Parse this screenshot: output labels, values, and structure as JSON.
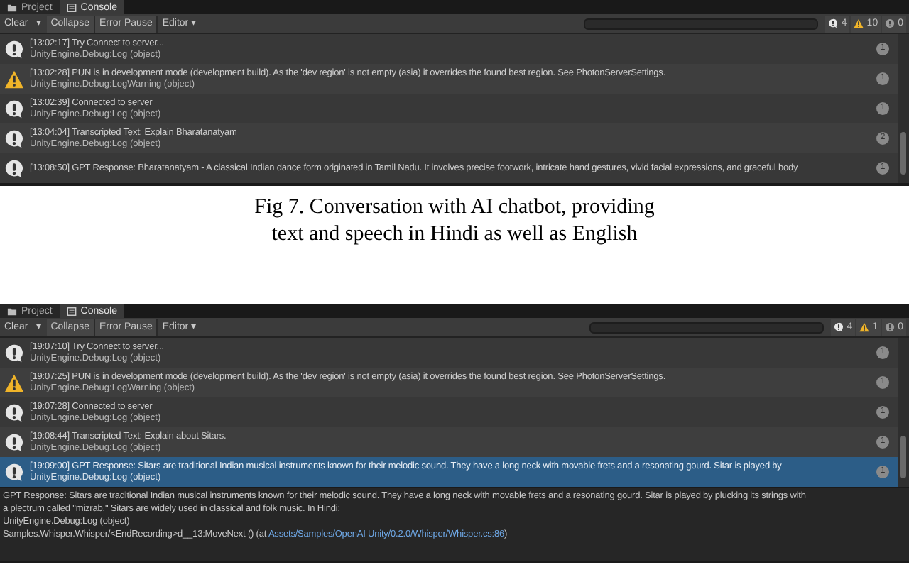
{
  "figures": [
    {
      "console": {
        "tabs": [
          {
            "label": "Project",
            "kind": "folder",
            "selected": false
          },
          {
            "label": "Console",
            "kind": "console",
            "selected": true
          }
        ],
        "toolbar": [
          {
            "label": "Clear",
            "kind": "plain"
          },
          {
            "label": "▾",
            "kind": "plain"
          },
          {
            "label": "Collapse",
            "kind": "toggle"
          },
          {
            "label": "Error Pause",
            "kind": "toggle"
          },
          {
            "label": "Editor ▾",
            "kind": "plain"
          }
        ],
        "counters": [
          {
            "kind": "info",
            "count": "4"
          },
          {
            "kind": "warning",
            "count": "10"
          },
          {
            "kind": "error",
            "count": "0"
          }
        ],
        "rows": [
          {
            "kind": "info",
            "selected": false,
            "message": "[13:02:17] Try Connect to server...",
            "source": "UnityEngine.Debug:Log (object)",
            "count": "1"
          },
          {
            "kind": "warning",
            "selected": false,
            "message": "[13:02:28] PUN is in development mode (development build). As the 'dev region' is not empty (asia) it overrides the found best region. See PhotonServerSettings.",
            "source": "UnityEngine.Debug:LogWarning (object)",
            "count": "1"
          },
          {
            "kind": "info",
            "selected": false,
            "message": "[13:02:39] Connected to server",
            "source": "UnityEngine.Debug:Log (object)",
            "count": "1"
          },
          {
            "kind": "info",
            "selected": false,
            "message": "[13:04:04] Transcripted Text: Explain Bharatanatyam",
            "source": "UnityEngine.Debug:Log (object)",
            "count": "2"
          },
          {
            "kind": "info",
            "selected": false,
            "message": "[13:08:50] GPT Response: Bharatanatyam - A classical Indian dance form originated in Tamil Nadu. It involves precise footwork, intricate hand gestures, vivid facial expressions, and graceful body",
            "count": "1"
          }
        ]
      },
      "caption": "Fig 7. Conversation with AI chatbot, providing text and speech in Hindi as well as English"
    },
    {
      "console": {
        "tabs": [
          {
            "label": "Project",
            "kind": "folder",
            "selected": false
          },
          {
            "label": "Console",
            "kind": "console",
            "selected": true
          }
        ],
        "toolbar": [
          {
            "label": "Clear",
            "kind": "plain"
          },
          {
            "label": "▾",
            "kind": "plain"
          },
          {
            "label": "Collapse",
            "kind": "toggle"
          },
          {
            "label": "Error Pause",
            "kind": "toggle"
          },
          {
            "label": "Editor ▾",
            "kind": "plain"
          }
        ],
        "counters": [
          {
            "kind": "info",
            "count": "4"
          },
          {
            "kind": "warning",
            "count": "1"
          },
          {
            "kind": "error",
            "count": "0"
          }
        ],
        "rows": [
          {
            "kind": "info",
            "selected": false,
            "message": "[19:07:10] Try Connect to server...",
            "source": "UnityEngine.Debug:Log (object)",
            "count": "1"
          },
          {
            "kind": "warning",
            "selected": false,
            "message": "[19:07:25] PUN is in development mode (development build). As the 'dev region' is not empty (asia) it overrides the found best region. See PhotonServerSettings.",
            "source": "UnityEngine.Debug:LogWarning (object)",
            "count": "1"
          },
          {
            "kind": "info",
            "selected": false,
            "message": "[19:07:28] Connected to server",
            "source": "UnityEngine.Debug:Log (object)",
            "count": "1"
          },
          {
            "kind": "info",
            "selected": false,
            "message": "[19:08:44] Transcripted Text: Explain about Sitars.",
            "source": "UnityEngine.Debug:Log (object)",
            "count": "1"
          },
          {
            "kind": "info",
            "selected": true,
            "message": "[19:09:00] GPT Response: Sitars are traditional Indian musical instruments known for their melodic sound. They have a long neck with movable frets and a resonating gourd. Sitar is played by",
            "source": "UnityEngine.Debug:Log (object)",
            "count": "1"
          }
        ],
        "detail": [
          {
            "kind": "text",
            "text": "GPT Response: Sitars are traditional Indian musical instruments known for their melodic sound. They have a long neck with movable frets and a resonating gourd. Sitar is played by plucking its strings with"
          },
          {
            "kind": "text",
            "text": "a plectrum called \"mizrab.\" Sitars are widely used in classical and folk music. In Hindi:"
          },
          {
            "kind": "text",
            "text": "UnityEngine.Debug:Log (object)"
          },
          {
            "kind": "trace",
            "text": "Samples.Whisper.Whisper/<EndRecording>d__13:MoveNext () (at ",
            "link": "Assets/Samples/OpenAI Unity/0.2.0/Whisper/Whisper.cs:86",
            "after": ")"
          }
        ]
      }
    }
  ]
}
